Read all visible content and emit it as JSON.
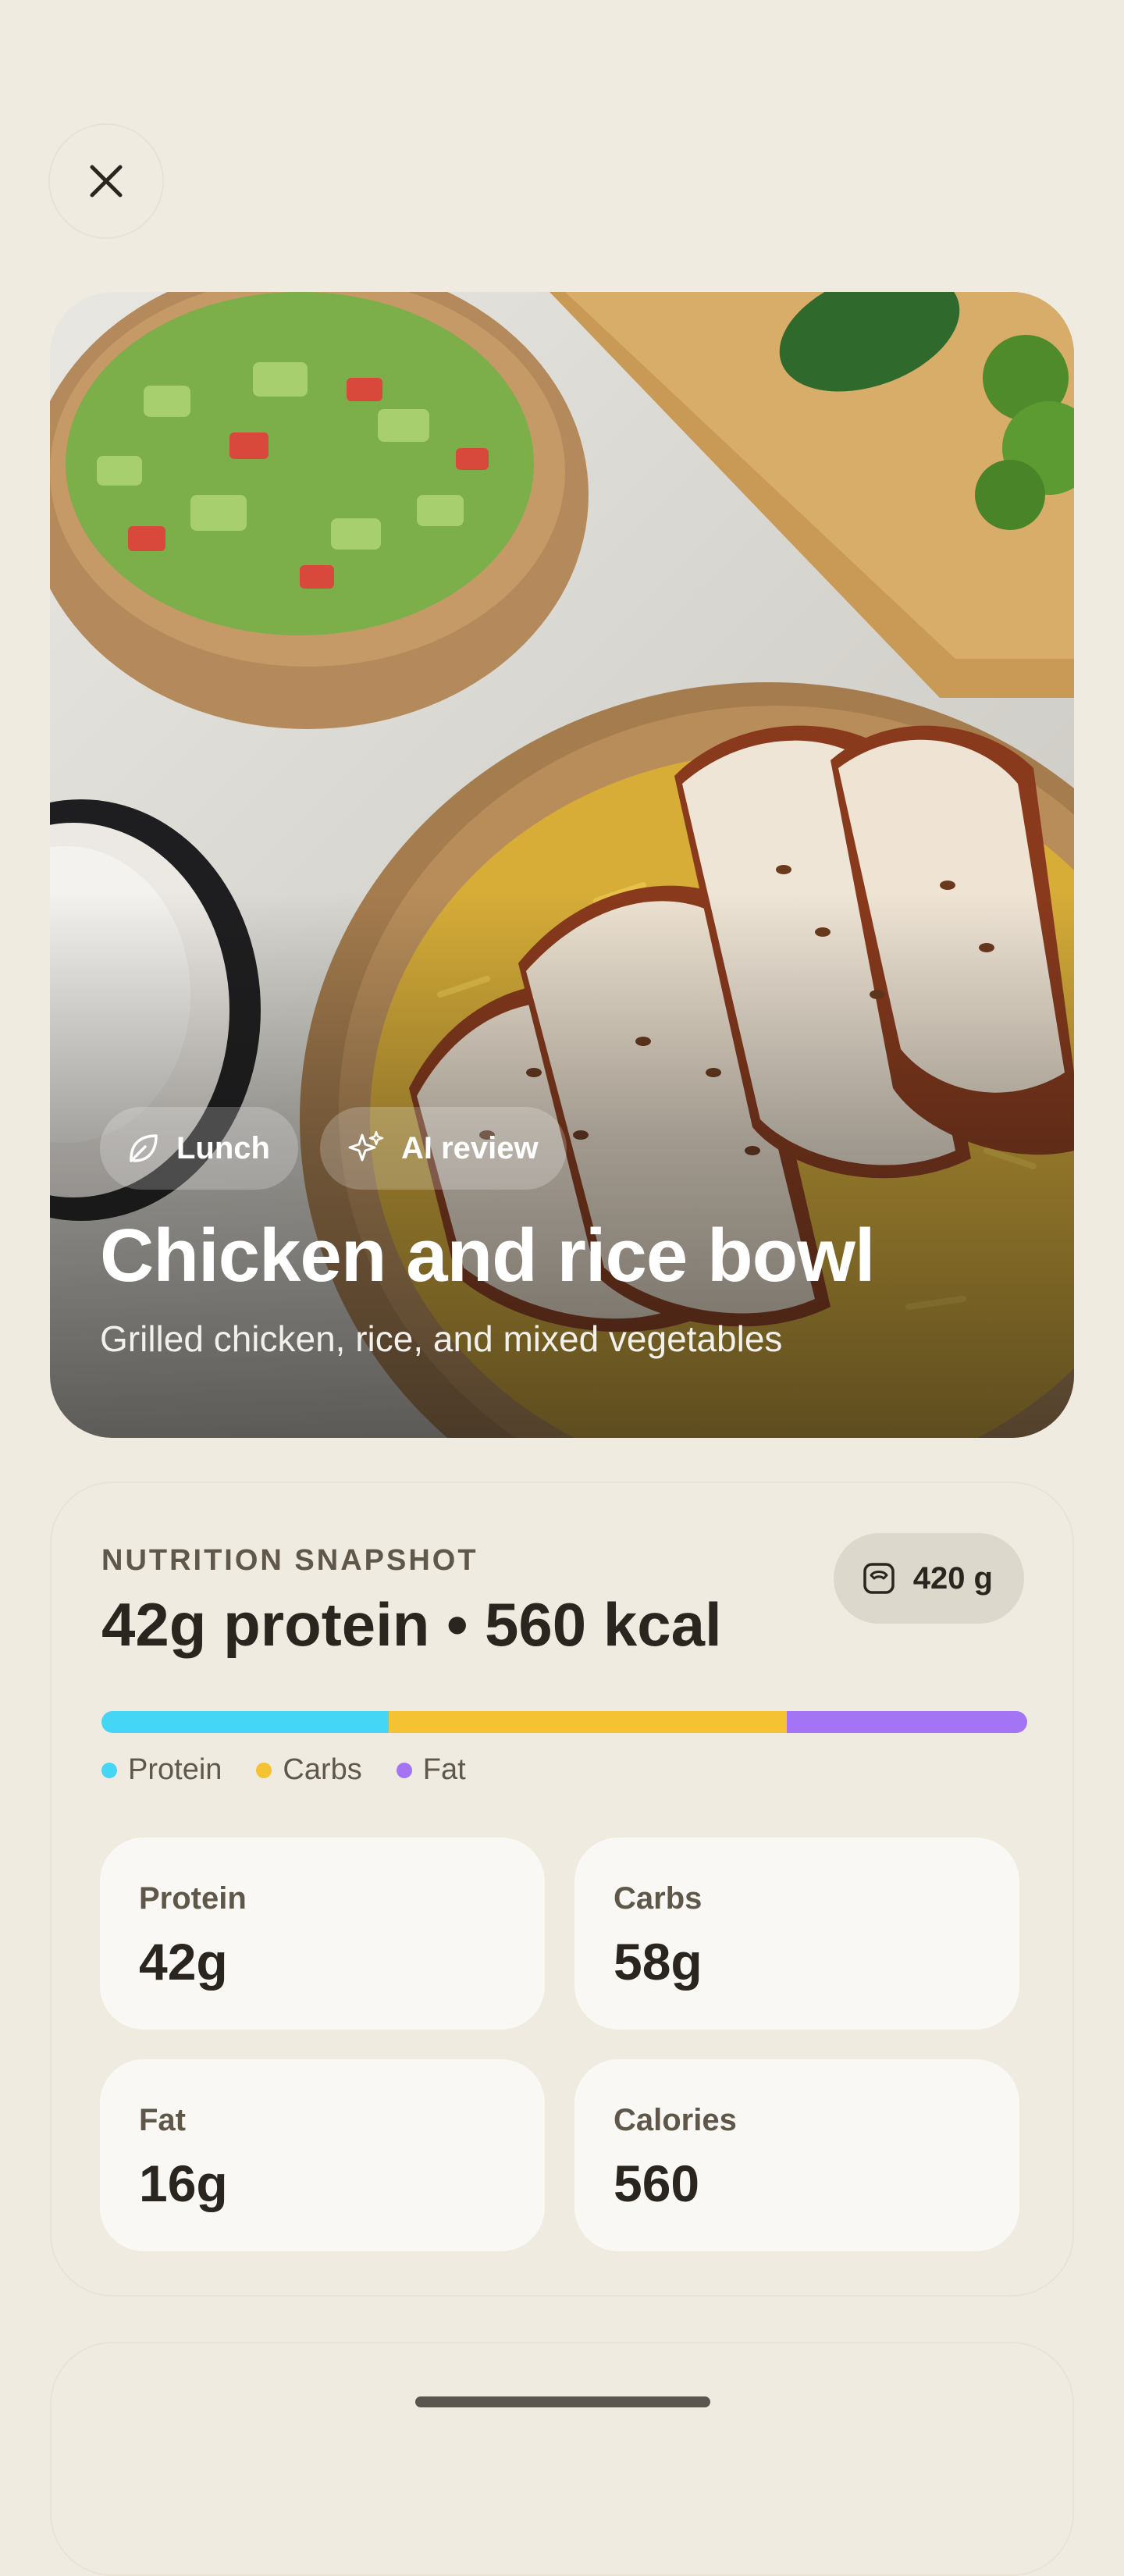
{
  "meal": {
    "title": "Chicken and rice bowl",
    "description": "Grilled chicken, rice, and mixed vegetables",
    "chips": [
      {
        "label": "Lunch",
        "icon": "leaf-icon"
      },
      {
        "label": "AI review",
        "icon": "sparkles-icon"
      }
    ]
  },
  "nutrition": {
    "section_label": "NUTRITION SNAPSHOT",
    "headline": "42g protein • 560 kcal",
    "weight": "420 g",
    "weight_icon": "scale-icon",
    "macro_split": [
      {
        "name": "Protein",
        "fraction": 0.31,
        "color": "#45d5f5"
      },
      {
        "name": "Carbs",
        "fraction": 0.43,
        "color": "#f5c233"
      },
      {
        "name": "Fat",
        "fraction": 0.26,
        "color": "#a374f4"
      }
    ],
    "legend": [
      "Protein",
      "Carbs",
      "Fat"
    ],
    "tiles": [
      {
        "label": "Protein",
        "value": "42g"
      },
      {
        "label": "Carbs",
        "value": "58g"
      },
      {
        "label": "Fat",
        "value": "16g"
      },
      {
        "label": "Calories",
        "value": "560"
      }
    ]
  },
  "icons": {
    "close": "close-icon"
  }
}
